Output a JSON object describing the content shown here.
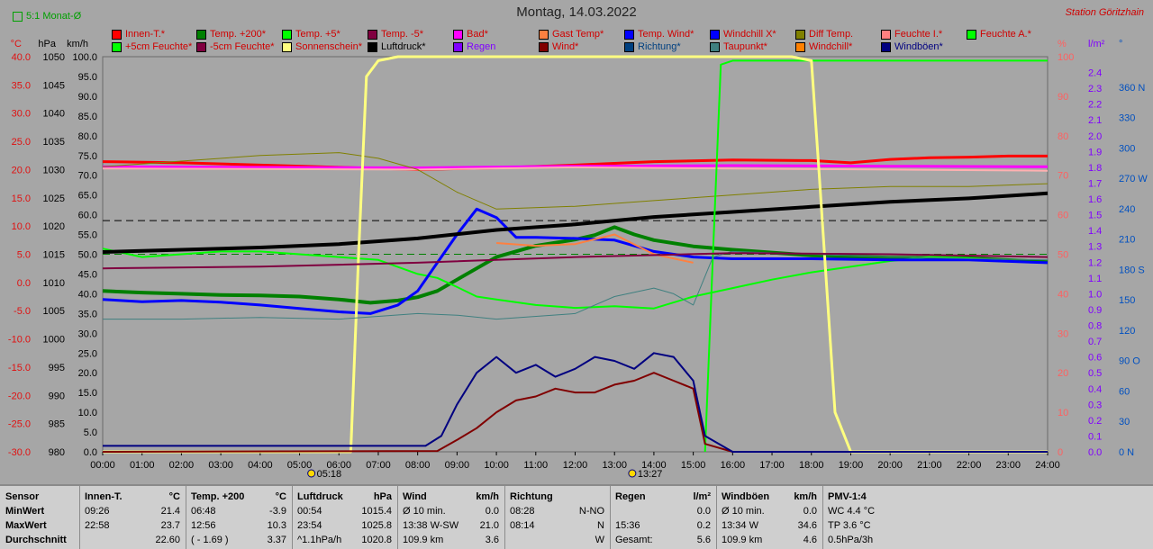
{
  "header": {
    "zoom_label": "5:1 Monat-Ø",
    "title": "Montag, 14.03.2022",
    "station": "Station Göritzhain"
  },
  "axes": {
    "temp": {
      "unit": "°C",
      "color": "#e01010",
      "ticks": [
        "40.0",
        "35.0",
        "30.0",
        "25.0",
        "20.0",
        "15.0",
        "10.0",
        "5.0",
        "0.0",
        "-5.0",
        "-10.0",
        "-15.0",
        "-20.0",
        "-25.0",
        "-30.0"
      ]
    },
    "pressure": {
      "unit": "hPa",
      "color": "#000000",
      "ticks": [
        "1050",
        "1045",
        "1040",
        "1035",
        "1030",
        "1025",
        "1020",
        "1015",
        "1010",
        "1005",
        "1000",
        "995",
        "990",
        "985",
        "980"
      ]
    },
    "wind": {
      "unit": "km/h",
      "color": "#000000",
      "ticks": [
        "100.0",
        "95.0",
        "90.0",
        "85.0",
        "80.0",
        "75.0",
        "70.0",
        "65.0",
        "60.0",
        "55.0",
        "50.0",
        "45.0",
        "40.0",
        "35.0",
        "30.0",
        "25.0",
        "20.0",
        "15.0",
        "10.0",
        "5.0",
        "0.0"
      ]
    },
    "humidity": {
      "unit": "%",
      "color": "#e07070",
      "ticks": [
        "100",
        "90",
        "80",
        "70",
        "60",
        "50",
        "40",
        "30",
        "20",
        "10",
        "0"
      ]
    },
    "rain": {
      "unit": "l/m²",
      "color": "#8000ff",
      "ticks": [
        "2.4",
        "2.3",
        "2.2",
        "2.1",
        "2.0",
        "1.9",
        "1.8",
        "1.7",
        "1.6",
        "1.5",
        "1.4",
        "1.3",
        "1.2",
        "1.1",
        "1.0",
        "0.9",
        "0.8",
        "0.7",
        "0.6",
        "0.5",
        "0.4",
        "0.3",
        "0.2",
        "0.1",
        "0.0"
      ]
    },
    "direction": {
      "unit": "°",
      "color": "#0050c0",
      "ticks": [
        "360 N",
        "330",
        "300",
        "270 W",
        "240",
        "210",
        "180 S",
        "150",
        "120",
        "90 O",
        "60",
        "30",
        "0 N"
      ]
    },
    "time_ticks": [
      "00:00",
      "01:00",
      "02:00",
      "03:00",
      "04:00",
      "05:00",
      "06:00",
      "07:00",
      "08:00",
      "09:00",
      "10:00",
      "11:00",
      "12:00",
      "13:00",
      "14:00",
      "15:00",
      "16:00",
      "17:00",
      "18:00",
      "19:00",
      "20:00",
      "21:00",
      "22:00",
      "23:00",
      "24:00"
    ],
    "sunrise": "05:18",
    "sunset": "13:27"
  },
  "legend": [
    {
      "label": "Innen-T.*",
      "color": "#ff0000",
      "text_color": "#d00000"
    },
    {
      "label": "Temp. +200*",
      "color": "#008000",
      "text_color": "#d00000"
    },
    {
      "label": "Temp. +5*",
      "color": "#00ff00",
      "text_color": "#d00000"
    },
    {
      "label": "Temp. -5*",
      "color": "#800040",
      "text_color": "#d00000"
    },
    {
      "label": "Bad*",
      "color": "#ff00ff",
      "text_color": "#d00000"
    },
    {
      "label": "Gast Temp*",
      "color": "#ff8040",
      "text_color": "#d00000"
    },
    {
      "label": "Temp. Wind*",
      "color": "#0000ff",
      "text_color": "#d00000"
    },
    {
      "label": "Windchill X*",
      "color": "#0000ff",
      "text_color": "#d00000"
    },
    {
      "label": "Diff Temp.",
      "color": "#808000",
      "text_color": "#d00000"
    },
    {
      "label": "Feuchte I.*",
      "color": "#ff8080",
      "text_color": "#d00000"
    },
    {
      "label": "Feuchte A.*",
      "color": "#00ff00",
      "text_color": "#d00000"
    },
    {
      "label": "+5cm Feuchte*",
      "color": "#00ff00",
      "text_color": "#d00000"
    },
    {
      "label": "-5cm Feuchte*",
      "color": "#800040",
      "text_color": "#d00000"
    },
    {
      "label": "Sonnenschein*",
      "color": "#ffff80",
      "text_color": "#d00000"
    },
    {
      "label": "Luftdruck*",
      "color": "#000000",
      "text_color": "#000000"
    },
    {
      "label": "Regen",
      "color": "#8000ff",
      "text_color": "#8000ff"
    },
    {
      "label": "Wind*",
      "color": "#800000",
      "text_color": "#d00000"
    },
    {
      "label": "Richtung*",
      "color": "#004080",
      "text_color": "#004080"
    },
    {
      "label": "Taupunkt*",
      "color": "#408080",
      "text_color": "#d00000"
    },
    {
      "label": "Windchill*",
      "color": "#ff8000",
      "text_color": "#d00000"
    },
    {
      "label": "Windböen*",
      "color": "#000080",
      "text_color": "#000080"
    }
  ],
  "chart_data": {
    "type": "line",
    "x_unit": "time of day",
    "xlim": [
      "00:00",
      "24:00"
    ],
    "series": [
      {
        "name": "Innen-T.*",
        "axis": "temp",
        "color": "#ff0000",
        "width": 3,
        "x": [
          0,
          2,
          4,
          6,
          8,
          10,
          12,
          14,
          16,
          18,
          19,
          20,
          21,
          22,
          23,
          24
        ],
        "y": [
          21.4,
          21.2,
          20.8,
          20.4,
          20.0,
          20.3,
          20.8,
          21.4,
          21.7,
          21.6,
          21.2,
          21.8,
          22.1,
          22.2,
          22.4,
          22.4
        ]
      },
      {
        "name": "Bad*",
        "axis": "temp",
        "color": "#ff00ff",
        "width": 3,
        "x": [
          0,
          4,
          8,
          12,
          16,
          20,
          24
        ],
        "y": [
          20.5,
          20.4,
          20.3,
          20.6,
          20.7,
          20.6,
          20.5
        ]
      },
      {
        "name": "Feuchte I.*",
        "axis": "temp",
        "color": "#ffb0b0",
        "width": 2,
        "x": [
          0,
          4,
          8,
          12,
          16,
          20,
          24
        ],
        "y": [
          20.2,
          20.1,
          20.0,
          20.4,
          20.2,
          20.0,
          19.8
        ]
      },
      {
        "name": "Temp. +200*",
        "axis": "temp",
        "color": "#008000",
        "width": 4,
        "x": [
          0,
          1,
          2,
          3,
          4,
          5,
          6,
          6.8,
          7.5,
          8,
          8.5,
          9,
          9.5,
          10,
          11,
          12,
          12.5,
          13,
          13.5,
          14,
          15,
          16,
          18,
          20,
          22,
          23.5,
          24
        ],
        "y": [
          -1.5,
          -1.8,
          -2.0,
          -2.2,
          -2.3,
          -2.5,
          -3.0,
          -3.6,
          -3.2,
          -2.6,
          -1.5,
          0.5,
          2.5,
          4.5,
          6.5,
          7.6,
          8.4,
          9.8,
          8.5,
          7.5,
          6.4,
          5.8,
          4.8,
          4.4,
          4.3,
          3.8,
          3.6
        ]
      },
      {
        "name": "Temp. +5*",
        "axis": "temp",
        "color": "#00ff00",
        "width": 2,
        "x": [
          0,
          1,
          2,
          3,
          4,
          5,
          6,
          7,
          8,
          8.5,
          9,
          9.5,
          10,
          11,
          12,
          13,
          14,
          15,
          16,
          17,
          18,
          20,
          21,
          22,
          23,
          24
        ],
        "y": [
          6.0,
          4.5,
          5.0,
          5.5,
          5.5,
          5.0,
          4.5,
          4.0,
          1.5,
          0.8,
          -0.8,
          -2.5,
          -3.0,
          -4.0,
          -4.5,
          -4.2,
          -4.6,
          -2.5,
          -1.0,
          0.5,
          1.8,
          3.8,
          4.5,
          4.3,
          3.8,
          3.5
        ]
      },
      {
        "name": "Temp. Wind*",
        "axis": "temp",
        "color": "#0000ff",
        "width": 3,
        "x": [
          0,
          1,
          2,
          3,
          4,
          5,
          6,
          6.8,
          7.5,
          8,
          8.5,
          9,
          9.5,
          10,
          10.5,
          11,
          12,
          13,
          14,
          15,
          16,
          17,
          18,
          20,
          22,
          24
        ],
        "y": [
          -3.0,
          -3.4,
          -3.2,
          -3.5,
          -4.0,
          -4.6,
          -5.2,
          -5.5,
          -4.0,
          -1.5,
          3.5,
          8.5,
          13.0,
          11.5,
          8.0,
          8.0,
          7.8,
          7.5,
          5.5,
          4.5,
          4.2,
          4.2,
          4.2,
          4.0,
          4.0,
          3.5
        ]
      },
      {
        "name": "Gast Temp*",
        "axis": "temp",
        "color": "#ff8040",
        "width": 2,
        "x": [
          10,
          11,
          12,
          13,
          14,
          15
        ],
        "y": [
          7.0,
          6.5,
          6.8,
          8.5,
          5.0,
          3.5
        ]
      },
      {
        "name": "Luftdruck*",
        "axis": "pressure",
        "color": "#000000",
        "width": 4,
        "x": [
          0,
          2,
          4,
          6,
          8,
          10,
          12,
          14,
          16,
          18,
          20,
          22,
          24
        ],
        "y": [
          1015.4,
          1015.8,
          1016.2,
          1016.8,
          1017.8,
          1019.3,
          1020.3,
          1021.6,
          1022.5,
          1023.4,
          1024.3,
          1024.9,
          1025.8
        ]
      },
      {
        "name": "Diff Temp.",
        "axis": "temp",
        "color": "#808000",
        "width": 1,
        "x": [
          0,
          2,
          4,
          6,
          7,
          8,
          9,
          10,
          12,
          14,
          16,
          18,
          20,
          22,
          24
        ],
        "y": [
          20.5,
          21.5,
          22.5,
          23.0,
          22.0,
          20.0,
          16.0,
          13.0,
          13.5,
          14.5,
          15.5,
          16.5,
          17.0,
          17.0,
          17.5
        ]
      },
      {
        "name": "Feuchte A.*",
        "axis": "humidity",
        "color": "#00ff00",
        "width": 2,
        "x": [
          15.3,
          15.5,
          15.7,
          16,
          17,
          18,
          20,
          22,
          24
        ],
        "y": [
          0,
          50,
          98,
          99,
          99,
          99,
          99,
          99,
          99
        ]
      },
      {
        "name": "Sonnenschein*",
        "axis": "humidity",
        "color": "#ffff80",
        "width": 3,
        "x": [
          0,
          6.3,
          6.5,
          6.7,
          7,
          7.5,
          8,
          12,
          16,
          17.5,
          18,
          18.2,
          18.6,
          19,
          24
        ],
        "y": [
          0,
          0,
          50,
          95,
          99,
          100,
          100,
          100,
          100,
          100,
          99,
          70,
          10,
          0,
          0
        ]
      },
      {
        "name": "Taupunkt*",
        "axis": "temp",
        "color": "#408080",
        "width": 1,
        "x": [
          0,
          2,
          4,
          6,
          7,
          8,
          9,
          10,
          12,
          13,
          14,
          14.5,
          15,
          15.5,
          16,
          18,
          20,
          24
        ],
        "y": [
          -6.5,
          -6.5,
          -6.2,
          -6.5,
          -6.0,
          -5.5,
          -5.8,
          -6.5,
          -5.5,
          -2.5,
          -1.0,
          -2.0,
          -4.0,
          4.5,
          5.5,
          5.0,
          4.5,
          4.0
        ]
      },
      {
        "name": "Temp. -5*",
        "axis": "temp",
        "color": "#800040",
        "width": 2,
        "x": [
          0,
          4,
          8,
          12,
          16,
          20,
          24
        ],
        "y": [
          2.5,
          2.8,
          3.5,
          4.5,
          5.2,
          5.0,
          4.5
        ]
      },
      {
        "name": "Wind*",
        "axis": "wind",
        "color": "#800000",
        "width": 2,
        "x": [
          0,
          8.5,
          9,
          9.5,
          10,
          10.5,
          11,
          11.5,
          12,
          12.5,
          13,
          13.5,
          14,
          14.5,
          15,
          15.3,
          16,
          24
        ],
        "y": [
          0,
          0.2,
          3,
          6,
          10,
          13,
          14,
          16,
          15,
          15,
          17,
          18,
          20,
          18,
          16,
          2,
          0,
          0
        ]
      },
      {
        "name": "Windböen*",
        "axis": "wind",
        "color": "#000080",
        "width": 2,
        "x": [
          0,
          8.2,
          8.6,
          9,
          9.5,
          10,
          10.5,
          11,
          11.5,
          12,
          12.5,
          13,
          13.5,
          14,
          14.5,
          15,
          15.3,
          16,
          24
        ],
        "y": [
          1.5,
          1.5,
          4,
          12,
          20,
          24,
          20,
          22,
          19,
          21,
          24,
          23,
          21,
          25,
          24,
          18,
          4,
          0,
          0
        ]
      }
    ],
    "dashed_reference_lines": [
      {
        "axis": "wind",
        "value": 58.5,
        "color": "#000000"
      },
      {
        "axis": "wind",
        "value": 50.0,
        "color": "#008000"
      }
    ]
  },
  "stats": {
    "rows": [
      "Sensor",
      "MinWert",
      "MaxWert",
      "Durchschnitt"
    ],
    "columns": [
      {
        "title": "Innen-T.",
        "unit": "°C",
        "cells": [
          [
            "09:26",
            "21.4"
          ],
          [
            "22:58",
            "23.7"
          ],
          [
            "",
            "22.60"
          ]
        ]
      },
      {
        "title": "Temp. +200",
        "unit": "°C",
        "cells": [
          [
            "06:48",
            "-3.9"
          ],
          [
            "12:56",
            "10.3"
          ],
          [
            "( - 1.69 )",
            "3.37"
          ]
        ]
      },
      {
        "title": "Luftdruck",
        "unit": "hPa",
        "cells": [
          [
            "00:54",
            "1015.4"
          ],
          [
            "23:54",
            "1025.8"
          ],
          [
            "^1.1hPa/h",
            "1020.8"
          ]
        ]
      },
      {
        "title": "Wind",
        "unit": "km/h",
        "cells": [
          [
            "Ø 10 min.",
            "0.0"
          ],
          [
            "13:38  W-SW",
            "21.0"
          ],
          [
            "109.9 km",
            "3.6"
          ]
        ]
      },
      {
        "title": "Richtung",
        "unit": "",
        "cells": [
          [
            "08:28",
            "N-NO"
          ],
          [
            "08:14",
            "N"
          ],
          [
            "",
            "W"
          ]
        ]
      },
      {
        "title": "Regen",
        "unit": "l/m²",
        "cells": [
          [
            "",
            "0.0"
          ],
          [
            "15:36",
            "0.2"
          ],
          [
            "Gesamt:",
            "5.6"
          ]
        ]
      },
      {
        "title": "Windböen",
        "unit": "km/h",
        "cells": [
          [
            "Ø 10 min.",
            "0.0"
          ],
          [
            "13:34  W",
            "34.6"
          ],
          [
            "109.9 km",
            "4.6"
          ]
        ]
      },
      {
        "title": "PMV-1:4",
        "unit": "",
        "cells": [
          [
            "WC 4.4 °C",
            ""
          ],
          [
            "TP 3.6 °C",
            ""
          ],
          [
            "0.5hPa/3h",
            ""
          ]
        ]
      }
    ]
  }
}
